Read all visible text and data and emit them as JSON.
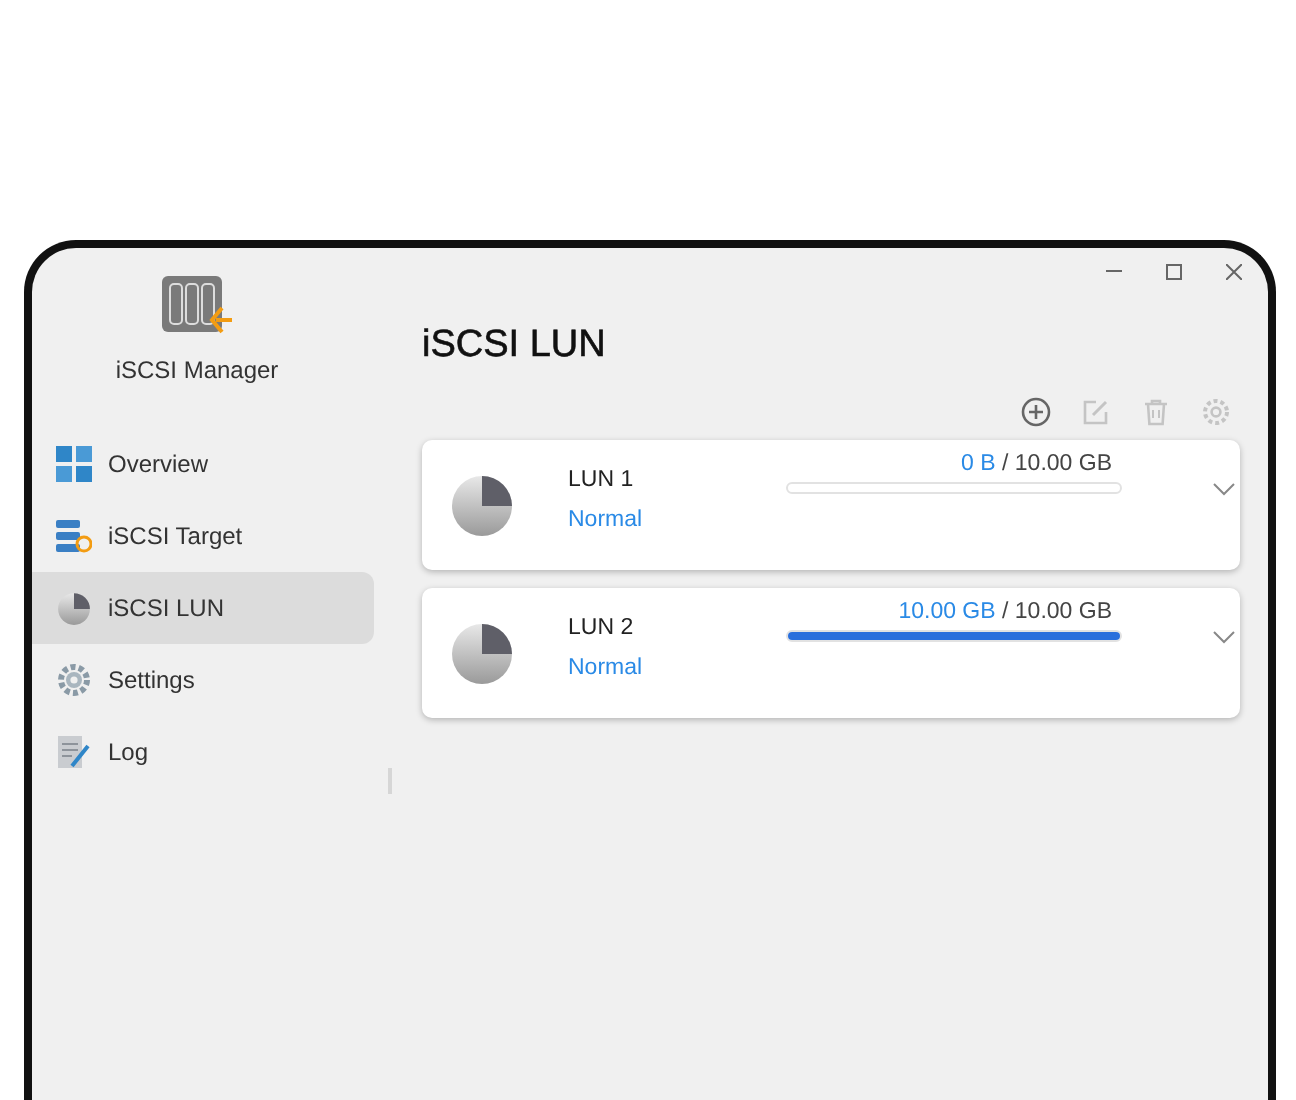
{
  "app": {
    "name": "iSCSI Manager"
  },
  "sidebar": {
    "items": [
      {
        "label": "Overview",
        "kind": "overview",
        "selected": false
      },
      {
        "label": "iSCSI Target",
        "kind": "target",
        "selected": false
      },
      {
        "label": "iSCSI LUN",
        "kind": "lun",
        "selected": true
      },
      {
        "label": "Settings",
        "kind": "settings",
        "selected": false
      },
      {
        "label": "Log",
        "kind": "log",
        "selected": false
      }
    ]
  },
  "page": {
    "title": "iSCSI LUN"
  },
  "toolbar": [
    {
      "kind": "add",
      "disabled": false
    },
    {
      "kind": "edit",
      "disabled": true
    },
    {
      "kind": "delete",
      "disabled": true
    },
    {
      "kind": "settings",
      "disabled": true
    }
  ],
  "luns": [
    {
      "name": "LUN 1",
      "status": "Normal",
      "used": "0 B",
      "separator": "/",
      "total": "10.00 GB",
      "level": 0.0
    },
    {
      "name": "LUN 2",
      "status": "Normal",
      "used": "10.00 GB",
      "separator": "/",
      "total": "10.00 GB",
      "level": 1.0
    }
  ]
}
